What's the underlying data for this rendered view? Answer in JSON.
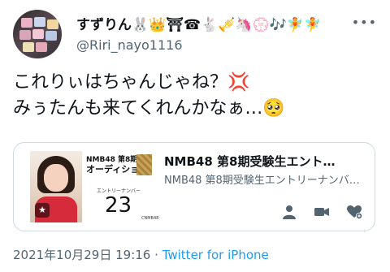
{
  "author": {
    "display_name": "すずりん🐰👑⛩☎🐇🎺🦄💮🎶🧚🧚",
    "handle": "@Riri_nayo1116"
  },
  "tweet": {
    "line1": "これりぃはちゃんじゃね？💢",
    "line2": "みぅたんも来てくれんかなぁ…🥺"
  },
  "card": {
    "title": "NMB48 第8期受験生エント…",
    "description": "NMB48 第8期受験生エントリーナンバ…",
    "thumb_audition_line1": "NMB48 第8期生",
    "thumb_audition_line2": "オーディション",
    "thumb_entry_label": "エントリーナンバー",
    "thumb_entry_number": "23",
    "thumb_small": "CNMB48"
  },
  "meta": {
    "timestamp": "2021年10月29日 19:16",
    "separator": "·",
    "source": "Twitter for iPhone"
  },
  "icons": {
    "more": "more-horizontal-icon",
    "person": "person-icon",
    "video": "video-camera-icon",
    "heart_plus": "heart-plus-icon",
    "star": "star-icon"
  },
  "colors": {
    "link": "#1d9bf0",
    "muted": "#536471",
    "border": "#cfd9de",
    "text": "#0f1419"
  }
}
